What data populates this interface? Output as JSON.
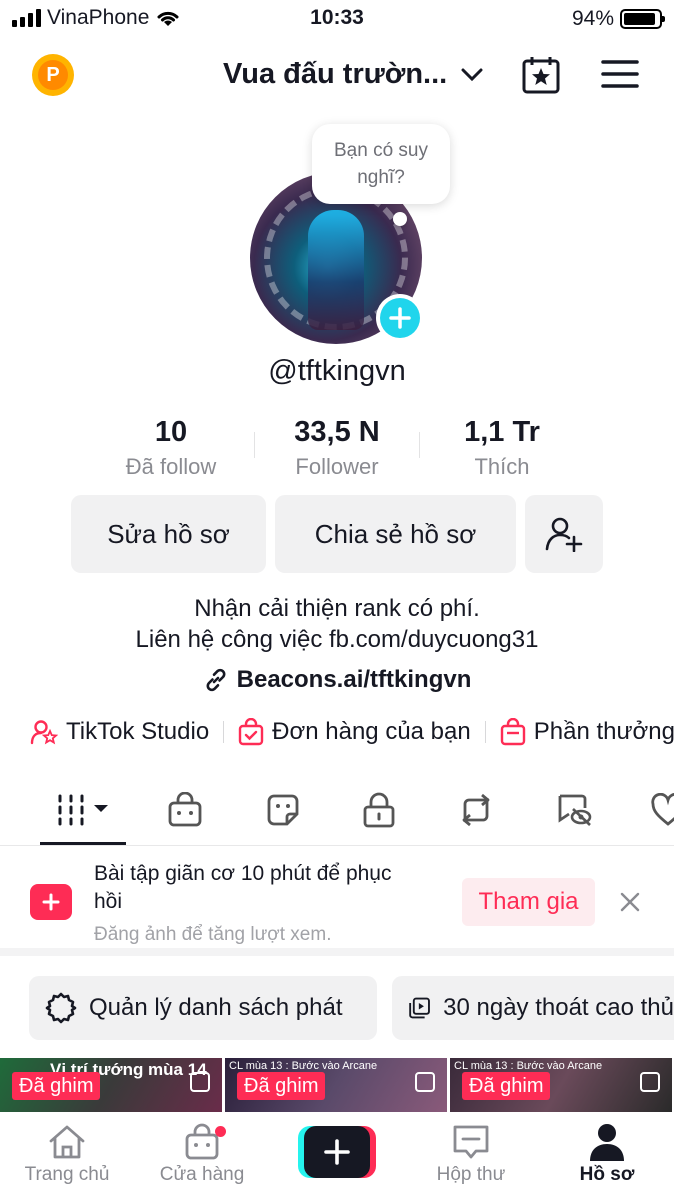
{
  "status_bar": {
    "carrier": "VinaPhone",
    "time": "10:33",
    "battery": "94%"
  },
  "header": {
    "account_name": "Vua đấu trườn...",
    "icons": [
      "p-coin-icon",
      "chevron-down-icon",
      "calendar-star-icon",
      "menu-icon"
    ],
    "coin_letter": "P"
  },
  "profile": {
    "bubble_text": "Bạn có suy nghĩ?",
    "username": "@tftkingvn",
    "stats": [
      {
        "value": "10",
        "label": "Đã follow"
      },
      {
        "value": "33,5 N",
        "label": "Follower"
      },
      {
        "value": "1,1 Tr",
        "label": "Thích"
      }
    ],
    "buttons": {
      "edit": "Sửa hồ sơ",
      "share": "Chia sẻ hồ sơ"
    },
    "bio_line1": "Nhận cải thiện rank có phí.",
    "bio_line2": "Liên hệ công việc fb.com/duycuong31",
    "link": "Beacons.ai/tftkingvn"
  },
  "shortcuts": [
    {
      "label": "TikTok Studio",
      "icon": "studio-icon"
    },
    {
      "label": "Đơn hàng của bạn",
      "icon": "order-bag-icon"
    },
    {
      "label": "Phần thưởng",
      "icon": "shop-bag-icon"
    }
  ],
  "promo": {
    "title": "Bài tập giãn cơ 10 phút để phục hồi",
    "subtitle": "Đăng ảnh để tăng lượt xem.",
    "action": "Tham gia"
  },
  "playlists": [
    {
      "label": "Quản lý danh sách phát"
    },
    {
      "label": "30 ngày thoát cao thủ"
    }
  ],
  "thumbnails": [
    {
      "pinned": "Đã ghim",
      "caption": "Vị trí tướng mùa 14"
    },
    {
      "pinned": "Đã ghim",
      "caption": "CL mùa 13 : Bước vào Arcane"
    },
    {
      "pinned": "Đã ghim",
      "caption": "CL mùa 13 : Bước vào Arcane"
    }
  ],
  "bottom_nav": [
    {
      "label": "Trang chủ"
    },
    {
      "label": "Cửa hàng"
    },
    {
      "label": ""
    },
    {
      "label": "Hộp thư"
    },
    {
      "label": "Hồ sơ"
    }
  ],
  "colors": {
    "accent": "#fe2c55",
    "cyan": "#25f4ee",
    "text": "#161823",
    "muted": "#8a8b91"
  }
}
